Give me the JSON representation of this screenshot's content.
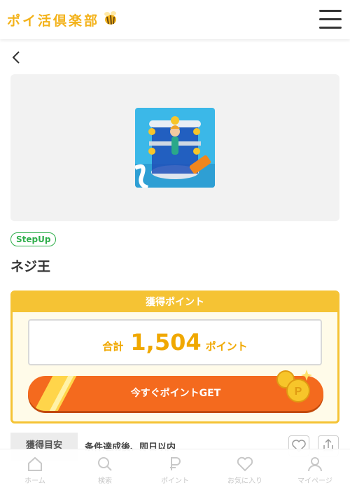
{
  "header": {
    "logo_text": "ポイ活倶楽部",
    "colors": {
      "brand": "#f3b21a"
    }
  },
  "hero": {
    "app_icon": "pin-puzzle-game-icon"
  },
  "app": {
    "badge": "StepUp",
    "name": "ネジ王"
  },
  "points": {
    "heading": "獲得ポイント",
    "total_label": "合計",
    "total_value": "1,504",
    "unit": "ポイント",
    "cta_label": "今すぐポイントGET",
    "colors": {
      "accent": "#f5c334",
      "cta": "#f46a1e"
    }
  },
  "estimate": {
    "label": "獲得目安",
    "text": "条件達成後、即日以内"
  },
  "bottom_nav": {
    "items": [
      {
        "label": "ホーム",
        "icon": "home-icon"
      },
      {
        "label": "検索",
        "icon": "search-icon"
      },
      {
        "label": "ポイント",
        "icon": "point-icon"
      },
      {
        "label": "お気に入り",
        "icon": "heart-icon"
      },
      {
        "label": "マイページ",
        "icon": "user-icon"
      }
    ]
  }
}
